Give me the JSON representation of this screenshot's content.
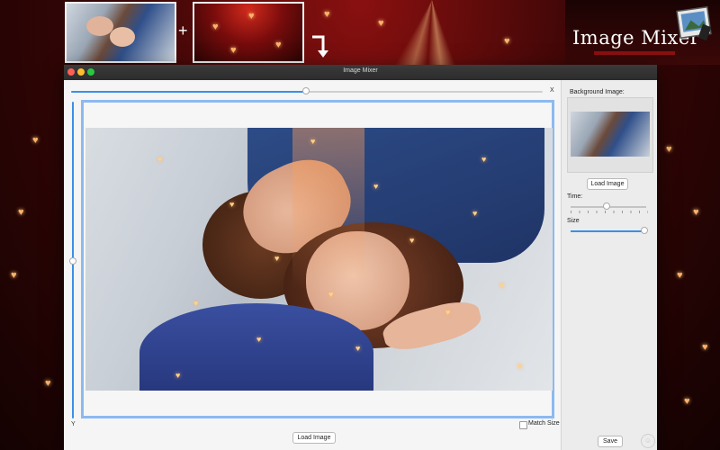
{
  "banner": {
    "plus_symbol": "+",
    "brand_title": "Image Mixer",
    "thumbnails": [
      {
        "name": "couple-photo"
      },
      {
        "name": "hearts-background"
      }
    ]
  },
  "window": {
    "title": "Image Mixer",
    "controls": [
      "close",
      "minimize",
      "zoom"
    ]
  },
  "main": {
    "x_axis_label": "X",
    "y_axis_label": "Y",
    "x_slider_value": 0.5,
    "y_slider_value": 0.5,
    "match_size_label": "Match Size",
    "match_size_checked": false,
    "load_image_button": "Load Image"
  },
  "sidebar": {
    "background_image_label": "Background Image:",
    "load_image_button": "Load Image",
    "time_label": "Time:",
    "time_value": 0.45,
    "size_label": "Size",
    "size_value": 1.0,
    "save_button": "Save"
  },
  "colors": {
    "accent": "#3b8fe8",
    "canvas_border": "#8db9f0",
    "titlebar": "#2e2e2e",
    "background_red": "#7a0c0c"
  }
}
